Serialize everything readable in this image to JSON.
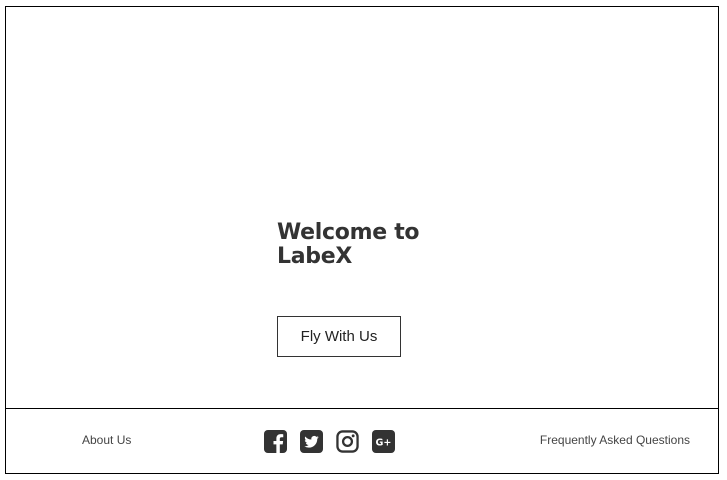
{
  "hero": {
    "headline": "Welcome to LabeX",
    "cta_label": "Fly With Us"
  },
  "footer": {
    "about_label": "About Us",
    "faq_label": "Frequently Asked Questions",
    "social_icons": [
      "facebook-icon",
      "twitter-icon",
      "instagram-icon",
      "google-plus-icon"
    ],
    "icon_color": "#333333",
    "google_plus_text": "G+"
  },
  "colors": {
    "border": "#000000",
    "text": "#333333",
    "background": "#ffffff"
  }
}
